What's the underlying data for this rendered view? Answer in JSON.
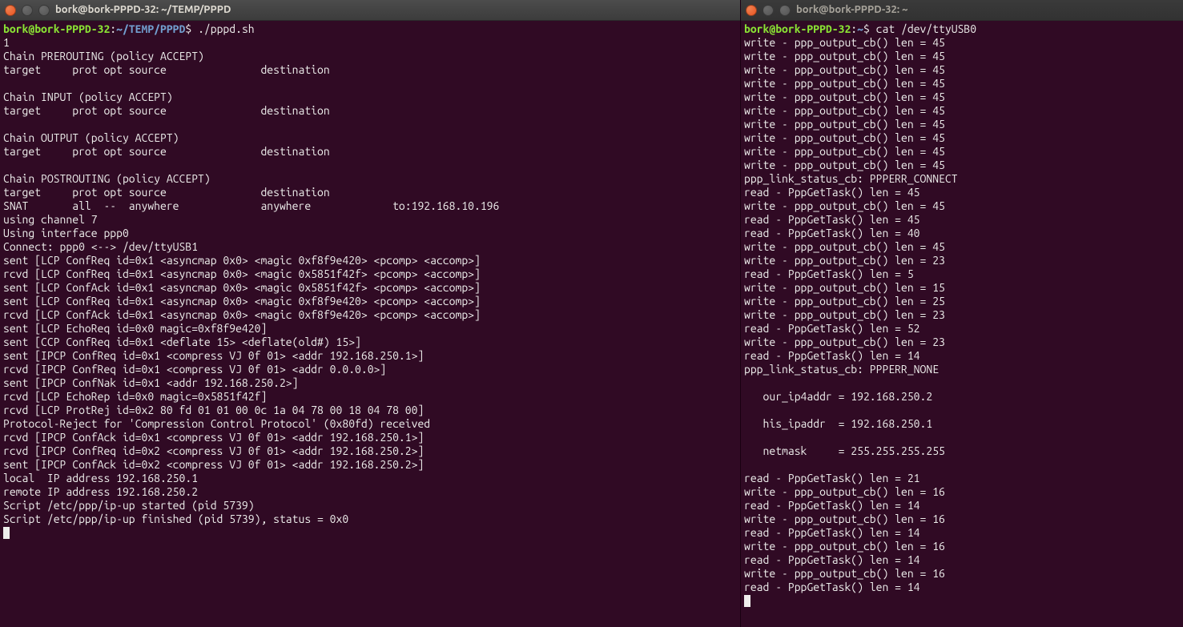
{
  "left": {
    "title": "bork@bork-PPPD-32: ~/TEMP/PPPD",
    "prompt_user": "bork@bork-PPPD-32",
    "prompt_sep1": ":",
    "prompt_path": "~/TEMP/PPPD",
    "prompt_sep2": "$ ",
    "command": "./pppd.sh",
    "lines": [
      "1",
      "Chain PREROUTING (policy ACCEPT)",
      "target     prot opt source               destination",
      "",
      "Chain INPUT (policy ACCEPT)",
      "target     prot opt source               destination",
      "",
      "Chain OUTPUT (policy ACCEPT)",
      "target     prot opt source               destination",
      "",
      "Chain POSTROUTING (policy ACCEPT)",
      "target     prot opt source               destination",
      "SNAT       all  --  anywhere             anywhere             to:192.168.10.196",
      "using channel 7",
      "Using interface ppp0",
      "Connect: ppp0 <--> /dev/ttyUSB1",
      "sent [LCP ConfReq id=0x1 <asyncmap 0x0> <magic 0xf8f9e420> <pcomp> <accomp>]",
      "rcvd [LCP ConfReq id=0x1 <asyncmap 0x0> <magic 0x5851f42f> <pcomp> <accomp>]",
      "sent [LCP ConfAck id=0x1 <asyncmap 0x0> <magic 0x5851f42f> <pcomp> <accomp>]",
      "sent [LCP ConfReq id=0x1 <asyncmap 0x0> <magic 0xf8f9e420> <pcomp> <accomp>]",
      "rcvd [LCP ConfAck id=0x1 <asyncmap 0x0> <magic 0xf8f9e420> <pcomp> <accomp>]",
      "sent [LCP EchoReq id=0x0 magic=0xf8f9e420]",
      "sent [CCP ConfReq id=0x1 <deflate 15> <deflate(old#) 15>]",
      "sent [IPCP ConfReq id=0x1 <compress VJ 0f 01> <addr 192.168.250.1>]",
      "rcvd [IPCP ConfReq id=0x1 <compress VJ 0f 01> <addr 0.0.0.0>]",
      "sent [IPCP ConfNak id=0x1 <addr 192.168.250.2>]",
      "rcvd [LCP EchoRep id=0x0 magic=0x5851f42f]",
      "rcvd [LCP ProtRej id=0x2 80 fd 01 01 00 0c 1a 04 78 00 18 04 78 00]",
      "Protocol-Reject for 'Compression Control Protocol' (0x80fd) received",
      "rcvd [IPCP ConfAck id=0x1 <compress VJ 0f 01> <addr 192.168.250.1>]",
      "rcvd [IPCP ConfReq id=0x2 <compress VJ 0f 01> <addr 192.168.250.2>]",
      "sent [IPCP ConfAck id=0x2 <compress VJ 0f 01> <addr 192.168.250.2>]",
      "local  IP address 192.168.250.1",
      "remote IP address 192.168.250.2",
      "Script /etc/ppp/ip-up started (pid 5739)",
      "Script /etc/ppp/ip-up finished (pid 5739), status = 0x0"
    ]
  },
  "right": {
    "title": "bork@bork-PPPD-32: ~",
    "prompt_user": "bork@bork-PPPD-32",
    "prompt_sep1": ":",
    "prompt_path": "~",
    "prompt_sep2": "$ ",
    "command": "cat /dev/ttyUSB0",
    "lines_top": [
      "write - ppp_output_cb() len = 45",
      "write - ppp_output_cb() len = 45",
      "write - ppp_output_cb() len = 45",
      "write - ppp_output_cb() len = 45",
      "write - ppp_output_cb() len = 45",
      "write - ppp_output_cb() len = 45",
      "write - ppp_output_cb() len = 45",
      "write - ppp_output_cb() len = 45",
      "write - ppp_output_cb() len = 45",
      "write - ppp_output_cb() len = 45",
      "ppp_link_status_cb: PPPERR_CONNECT",
      "read - PppGetTask() len = 45",
      "write - ppp_output_cb() len = 45",
      "read - PppGetTask() len = 45",
      "read - PppGetTask() len = 40",
      "write - ppp_output_cb() len = 45",
      "write - ppp_output_cb() len = 23",
      "read - PppGetTask() len = 5",
      "write - ppp_output_cb() len = 15",
      "write - ppp_output_cb() len = 25",
      "write - ppp_output_cb() len = 23",
      "read - PppGetTask() len = 52",
      "write - ppp_output_cb() len = 23",
      "read - PppGetTask() len = 14",
      "ppp_link_status_cb: PPPERR_NONE"
    ],
    "indented": [
      "   our_ip4addr = 192.168.250.2",
      "",
      "   his_ipaddr  = 192.168.250.1",
      "",
      "   netmask     = 255.255.255.255",
      ""
    ],
    "lines_bottom": [
      "read - PppGetTask() len = 21",
      "write - ppp_output_cb() len = 16",
      "read - PppGetTask() len = 14",
      "write - ppp_output_cb() len = 16",
      "read - PppGetTask() len = 14",
      "write - ppp_output_cb() len = 16",
      "read - PppGetTask() len = 14",
      "write - ppp_output_cb() len = 16",
      "read - PppGetTask() len = 14"
    ]
  }
}
